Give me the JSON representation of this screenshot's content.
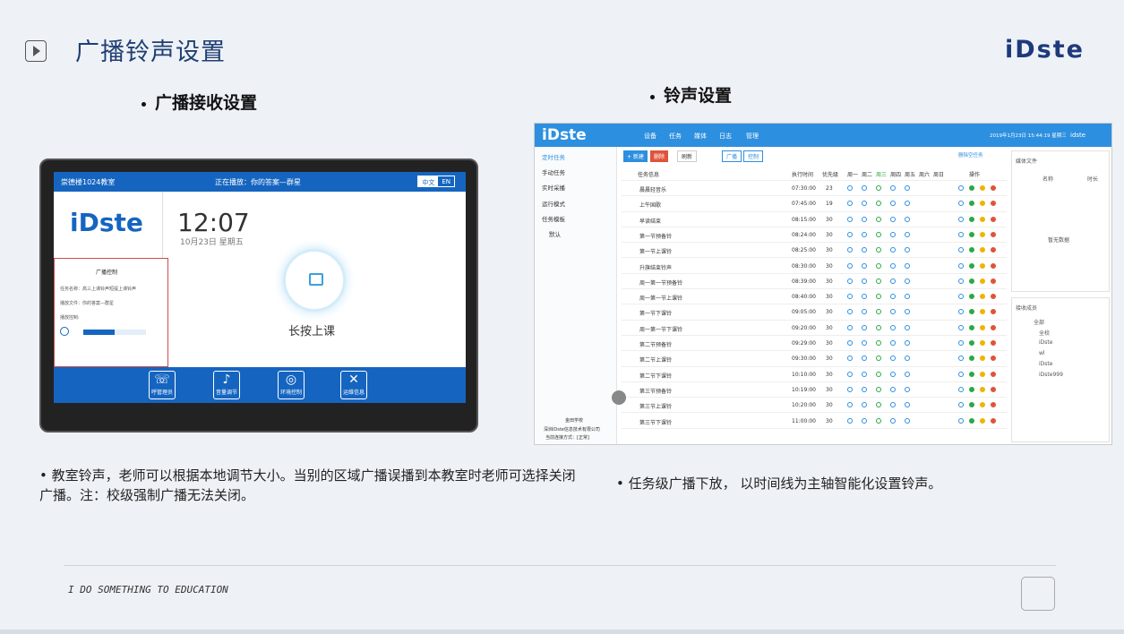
{
  "page": {
    "title": "广播铃声设置",
    "brand": "iDste",
    "left_heading": "广播接收设置",
    "right_heading": "铃声设置",
    "left_text": "教室铃声，老师可以根据本地调节大小。当别的区域广播误播到本教室时老师可选择关闭广播。注：校级强制广播无法关闭。",
    "right_text": "任务级广播下放， 以时间线为主轴智能化设置铃声。",
    "footer": "I DO SOMETHING TO EDUCATION"
  },
  "tablet": {
    "room": "崇德楼1024教室",
    "playing": "正在播放：你的答案—群星",
    "lang_cn": "中文",
    "lang_en": "EN",
    "logo": "iDste",
    "time": "12:07",
    "date": "10月23日 星期五",
    "press": "长按上课",
    "panel_title": "广播控制",
    "task_name": "任务名称：高三上课铃声短提上课铃声",
    "play_file": "播放文件：你的答案—群星",
    "control": "播放控制:",
    "buttons": [
      "呼管理员",
      "音量调节",
      "环境控制",
      "运维信息"
    ]
  },
  "app": {
    "logo": "iDste",
    "nav": [
      "设备",
      "任务",
      "媒体",
      "日志",
      "管理"
    ],
    "datetime": "2019年1月23日 15:44:19 星期三",
    "user": "idste",
    "side": [
      "定时任务",
      "手动任务",
      "实时采播",
      "运行模式",
      "任务模板",
      "默认"
    ],
    "side_footer": [
      "金田学校",
      "深圳iDste信息技术有限公司",
      "当前连接方式：[正常]"
    ],
    "tools": [
      "+ 新建",
      "删除",
      "刷新",
      "广播",
      "控制",
      "删除空任务"
    ],
    "headers": [
      "任务信息",
      "执行时间",
      "优先级",
      "周一",
      "周二",
      "周三",
      "周四",
      "周五",
      "周六",
      "周日",
      "操作"
    ],
    "rows": [
      [
        "晨晨轻音乐",
        "07:30:00",
        "23"
      ],
      [
        "上午国歌",
        "07:45:00",
        "19"
      ],
      [
        "早读结束",
        "08:15:00",
        "30"
      ],
      [
        "第一节预备铃",
        "08:24:00",
        "30"
      ],
      [
        "第一节上课铃",
        "08:25:00",
        "30"
      ],
      [
        "升旗结束铃声",
        "08:30:00",
        "30"
      ],
      [
        "周一第一节预备铃",
        "08:39:00",
        "30"
      ],
      [
        "周一第一节上课铃",
        "08:40:00",
        "30"
      ],
      [
        "第一节下课铃",
        "09:05:00",
        "30"
      ],
      [
        "周一第一节下课铃",
        "09:20:00",
        "30"
      ],
      [
        "第二节预备铃",
        "09:29:00",
        "30"
      ],
      [
        "第二节上课铃",
        "09:30:00",
        "30"
      ],
      [
        "第二节下课铃",
        "10:10:00",
        "30"
      ],
      [
        "第三节预备铃",
        "10:19:00",
        "30"
      ],
      [
        "第三节上课铃",
        "10:20:00",
        "30"
      ],
      [
        "第三节下课铃",
        "11:00:00",
        "30"
      ]
    ],
    "media_title": "媒体文件",
    "media_cols": [
      "名称",
      "时长"
    ],
    "no_data": "暂无数据",
    "recv_title": "接收成员",
    "tree": [
      "全部",
      "全校",
      "iDste",
      "wl",
      "iDste",
      "iDste999"
    ]
  }
}
